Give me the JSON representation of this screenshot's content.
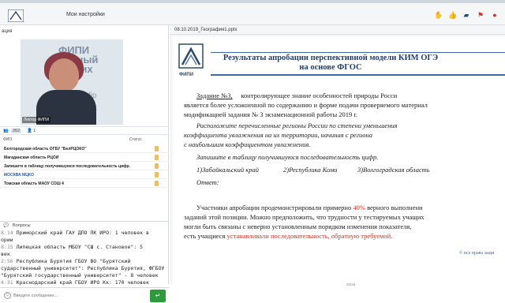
{
  "topbar": {
    "app_title": "Мои настройки",
    "url_fragment": "https://...webinar...content...presentation"
  },
  "left_panel": {
    "section_title": "ация",
    "video": {
      "bg_text": "ФИПИ\nальный\nческих",
      "bg_url": "www.fip",
      "caption": "Лектор ФИПИ"
    },
    "participants": {
      "count": "262",
      "extra": "1"
    },
    "table": {
      "col_name": "ФИО",
      "col_status": "Статус",
      "rows": [
        {
          "name": "Белгородская область ОГБУ \"БелРЦОКО\"",
          "link": false
        },
        {
          "name": "Магаданская область РЦОИ",
          "link": false
        },
        {
          "name": "Запишите в таблицу получившуюся последовательность цифр.",
          "link": false
        },
        {
          "name": "МОСКВА МЦКО",
          "link": true
        },
        {
          "name": "Томская область МАОУ СОШ 4",
          "link": false
        }
      ]
    },
    "chat": {
      "title": "Вопросы",
      "lines": [
        {
          "time": "8:14",
          "text": "Приморский край ГАУ ДПО ПК ИРО: 1 человек в"
        },
        {
          "time": "",
          "text": "ории"
        },
        {
          "time": "8:15",
          "text": "Липецкая область МБОУ \"СШ с. Становое\": 5"
        },
        {
          "time": "",
          "text": "век"
        },
        {
          "time": "2:56",
          "text": "Республика Бурятия ГБОУ ВО \"Бурятский"
        },
        {
          "time": "",
          "text": "сударственный университет\": Республика Бурятия, ФГБОУ"
        },
        {
          "time": "",
          "text": "\"Бурятский государственный университет\" - 8 человек"
        },
        {
          "time": "4:31",
          "text": "Краснодарский край ГБОУ ИРО Кк: 170 человек"
        }
      ],
      "input_placeholder": "Введите сообщение...",
      "send_symbol": "↵"
    }
  },
  "slide_panel": {
    "file_name": "08.10.2019_География1.pptx",
    "logo_text": "ФИПИ",
    "title_line1": "Результаты апробации перспективной модели КИМ ОГЭ",
    "title_line2": "на основе ФГОС",
    "p1_label": "Задание №3,",
    "p1_rest": "контролирующее знание особенностей природы Росси",
    "p1_l2": "является более усложненной по содержанию и форме подачи проверяемого материал",
    "p1_l3": "модификацией задания № 3 экзаменационной работы 2019 г.",
    "i1_l1": "Расположите перечисленные регионы России по степени уменьшения",
    "i1_l2": "коэффициента увлажнения на их территории, начиная с региона",
    "i1_l3": "с наибольшим коэффициентом увлажнения.",
    "i2": "Запишите в таблицу получившуюся последовательность цифр.",
    "opt1": "1)Забайкальский край",
    "opt2": "2)Республика Коми",
    "opt3": "3)Волгоградская область",
    "answer": "Ответ:",
    "p2_l1a": "Участники апробации продемонстрировали примерно ",
    "p2_pct": "40%",
    "p2_l1b": " верного выполнени",
    "p2_l2": "заданий этой позиции. Можно предположить, что трудности у тестируемых учащих",
    "p2_l3": "могли быть связаны с неверно установленным порядком изменения показателя,",
    "p2_l4a": "есть учащиеся ",
    "p2_l4b": "устанавливали последовательность, обратную требуемой.",
    "footnote": "© все права защи",
    "page_num": "20/26"
  },
  "colors": {
    "accent_blue": "#1f3f72",
    "highlight_red": "#c0392b",
    "send_green": "#2f9a3c"
  }
}
